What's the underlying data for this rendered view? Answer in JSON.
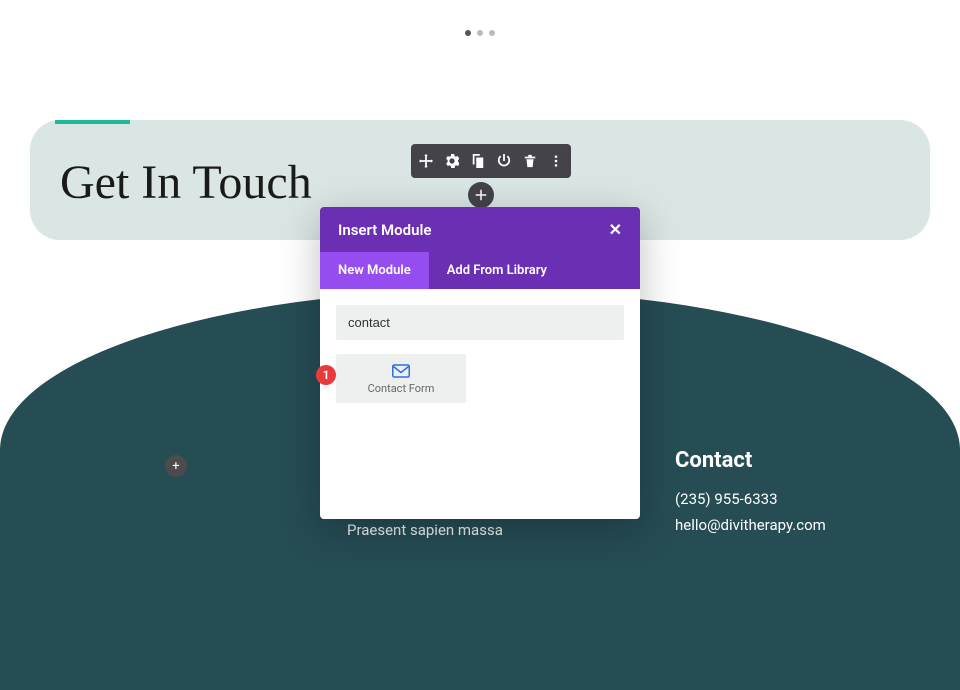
{
  "pagination": {
    "count": 3,
    "activeIndex": 0
  },
  "hero": {
    "title": "Get In Touch"
  },
  "modal": {
    "title": "Insert Module",
    "tabs": [
      {
        "label": "New Module",
        "active": true
      },
      {
        "label": "Add From Library",
        "active": false
      }
    ],
    "search_value": "contact",
    "results": [
      {
        "label": "Contact Form",
        "icon": "mail-icon"
      }
    ]
  },
  "annotation": {
    "number": "1"
  },
  "contact": {
    "heading": "Contact",
    "phone": "(235) 955-6333",
    "email": "hello@divitherapy.com"
  },
  "footer_snippet": "Praesent sapien massa",
  "colors": {
    "modal_header": "#6b2fb3",
    "modal_tab_active": "#954df0",
    "curve": "#264c54",
    "hero_bg": "#d9e6e4",
    "accent": "#1fb89c",
    "badge": "#e83a3a"
  }
}
